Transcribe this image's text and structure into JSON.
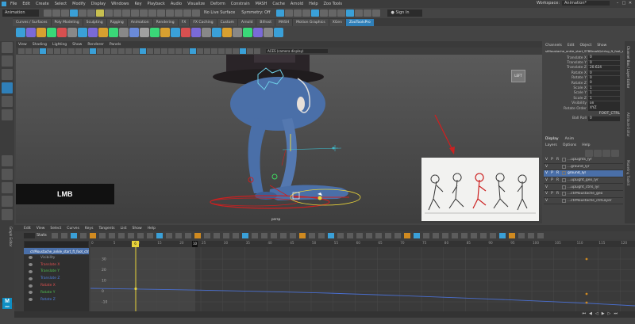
{
  "menubar": {
    "items": [
      "File",
      "Edit",
      "Create",
      "Select",
      "Modify",
      "Display",
      "Windows",
      "Key",
      "Playback",
      "Audio",
      "Visualize",
      "Deform",
      "Constrain",
      "MASH",
      "Cache",
      "Arnold",
      "Help",
      "Zoo Tools"
    ],
    "workspace_label": "Workspace:",
    "workspace_value": "Animation*"
  },
  "status_line": {
    "mode": "Animation",
    "surface": "No Live Surface",
    "symmetry": "Symmetry: Off",
    "sign_in": "Sign In"
  },
  "shelf": {
    "tabs": [
      "Curves / Surfaces",
      "Poly Modeling",
      "Sculpting",
      "Rigging",
      "Animation",
      "Rendering",
      "FX",
      "FX Caching",
      "Custom",
      "Arnold",
      "Bifrost",
      "MASH",
      "Motion Graphics",
      "XGen",
      "ZooToolsPro"
    ],
    "active_tab": "ZooToolsPro"
  },
  "viewport": {
    "menu": [
      "View",
      "Shading",
      "Lighting",
      "Show",
      "Renderer",
      "Panels"
    ],
    "camera_field": "persp",
    "color_space": "ACES (camera display)",
    "camera_label": "persp",
    "cube_label": "LEFT",
    "overlay_text": "LMB",
    "accent_red": "#cc2020",
    "character_color": "#4a6fa8"
  },
  "channel_box": {
    "menu": [
      "Channels",
      "Edit",
      "Object",
      "Show"
    ],
    "object_name": "stMoustache_ankle_start_STBBroaW/ctrlsg_ft_foot_ctrl",
    "channels": [
      {
        "name": "Translate X",
        "value": "0"
      },
      {
        "name": "Translate Y",
        "value": "0"
      },
      {
        "name": "Translate Z",
        "value": "20.624"
      },
      {
        "name": "Rotate X",
        "value": "0"
      },
      {
        "name": "Rotate Y",
        "value": "0"
      },
      {
        "name": "Rotate Z",
        "value": "0"
      },
      {
        "name": "Scale X",
        "value": "1"
      },
      {
        "name": "Scale Y",
        "value": "1"
      },
      {
        "name": "Scale Z",
        "value": "1"
      },
      {
        "name": "Visibility",
        "value": "on"
      },
      {
        "name": "Rotate Order",
        "value": "XYZ"
      }
    ],
    "inputs_label": "FOOT_CTRL",
    "extra_channel": "Ball Roll",
    "extra_value": "0"
  },
  "layers": {
    "tabs": [
      "Display",
      "Anim"
    ],
    "menu": [
      "Layers",
      "Options",
      "Help"
    ],
    "rows": [
      {
        "v": "V",
        "p": "P",
        "r": "R",
        "name": "...upLights_lyr",
        "selected": false
      },
      {
        "v": "V",
        "p": "",
        "r": "",
        "name": "...ground_lyr",
        "selected": false
      },
      {
        "v": "V",
        "p": "P",
        "r": "R",
        "name": "ground_lyr",
        "selected": true
      },
      {
        "v": "V",
        "p": "P",
        "r": "R",
        "name": "...upLight_geo_lyr",
        "selected": false
      },
      {
        "v": "V",
        "p": "",
        "r": "",
        "name": "...upLight_ctrls_lyr",
        "selected": false
      },
      {
        "v": "V",
        "p": "P",
        "r": "R",
        "name": "...ctrMoustache_geo",
        "selected": false
      },
      {
        "v": "V",
        "p": "",
        "r": "",
        "name": "...ctrMoustache_ctrlLayer",
        "selected": false
      }
    ]
  },
  "graph_editor": {
    "side_title": "Graph Editor",
    "menu": [
      "Edit",
      "View",
      "Select",
      "Curves",
      "Keys",
      "Tangents",
      "List",
      "Show",
      "Help"
    ],
    "stats_label": "Stats",
    "frame_marker": "6",
    "end_marker": "10",
    "outliner_root": "ctrMoustache_ankle_start_ft_foot_ctrl",
    "outliner_items": [
      {
        "label": "Visibility",
        "color": "#9aa0a8"
      },
      {
        "label": "Translate X",
        "color": "#e05050"
      },
      {
        "label": "Translate Y",
        "color": "#50c050"
      },
      {
        "label": "Translate Z",
        "color": "#5080e0"
      },
      {
        "label": "Rotate X",
        "color": "#e05050"
      },
      {
        "label": "Rotate Y",
        "color": "#50c050"
      },
      {
        "label": "Rotate Z",
        "color": "#5080e0"
      }
    ],
    "ruler_ticks": [
      "0",
      "5",
      "10",
      "15",
      "20",
      "25",
      "30",
      "35",
      "40",
      "45",
      "50",
      "55",
      "60",
      "65",
      "70",
      "75",
      "80",
      "85",
      "90",
      "95",
      "100",
      "105",
      "110",
      "115",
      "120"
    ],
    "y_ticks": [
      "30",
      "20",
      "10",
      "0",
      "-10"
    ],
    "current_frame_color": "#e8d33a",
    "curve_color": "#4a6fd0"
  },
  "sidebar_right": {
    "labels": [
      "Channel Box / Layer Editor",
      "Attribute Editor",
      "Modeling Toolkit"
    ]
  },
  "maya_icon": "M",
  "maya_icon_sub": "2020"
}
